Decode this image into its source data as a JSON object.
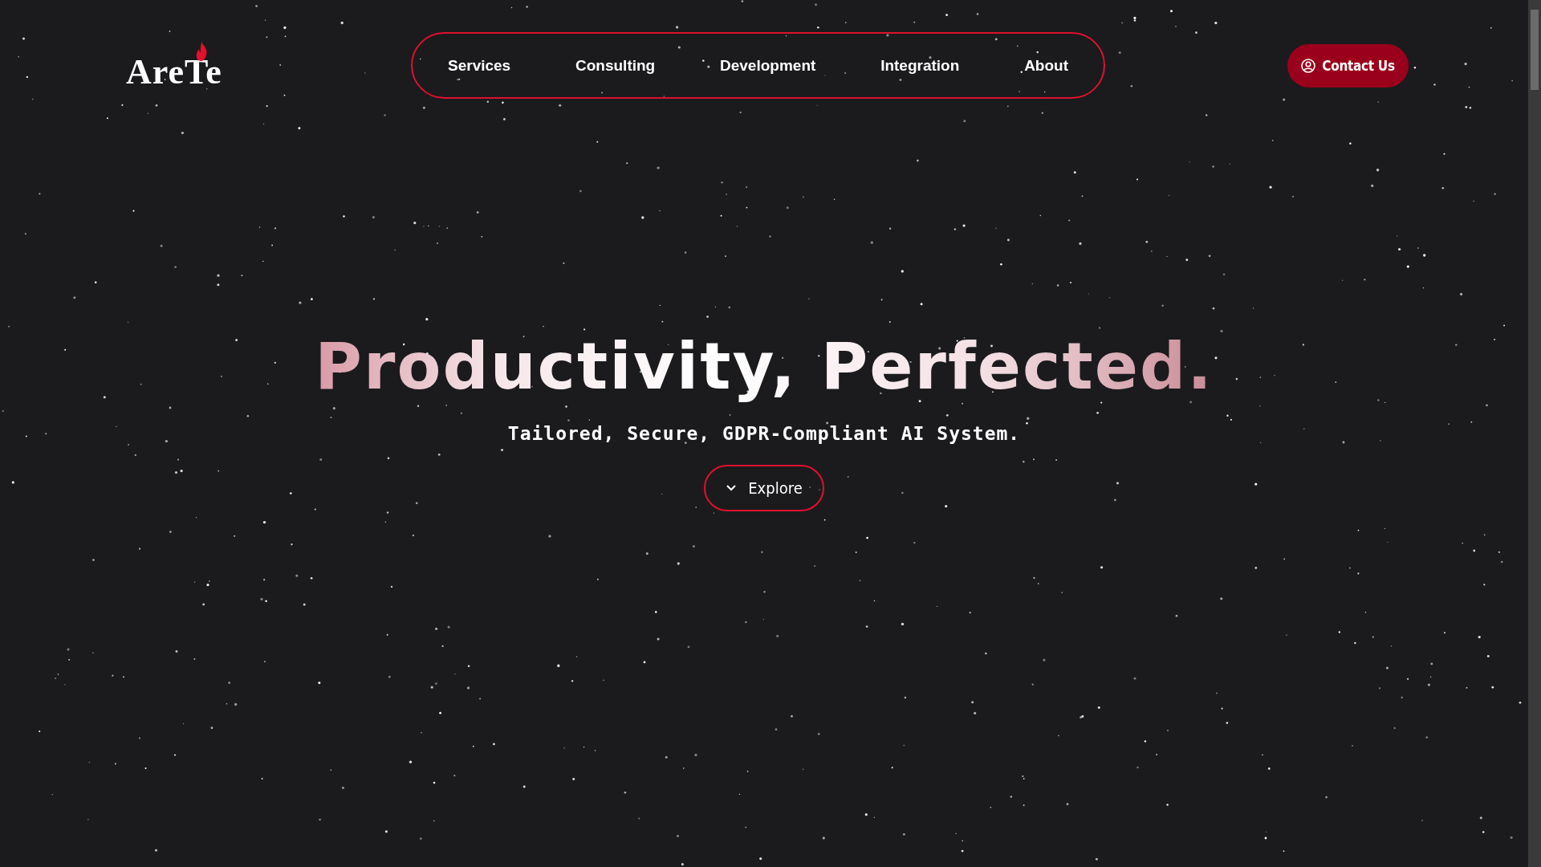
{
  "logo": {
    "text": "AreTe"
  },
  "nav": {
    "items": [
      {
        "label": "Services"
      },
      {
        "label": "Consulting"
      },
      {
        "label": "Development"
      },
      {
        "label": "Integration"
      },
      {
        "label": "About"
      }
    ]
  },
  "contact_button": {
    "label": "Contact Us"
  },
  "hero": {
    "title": "Productivity, Perfected.",
    "subtitle": "Tailored, Secure, GDPR-Compliant AI System.",
    "button": {
      "label": "Explore"
    }
  }
}
